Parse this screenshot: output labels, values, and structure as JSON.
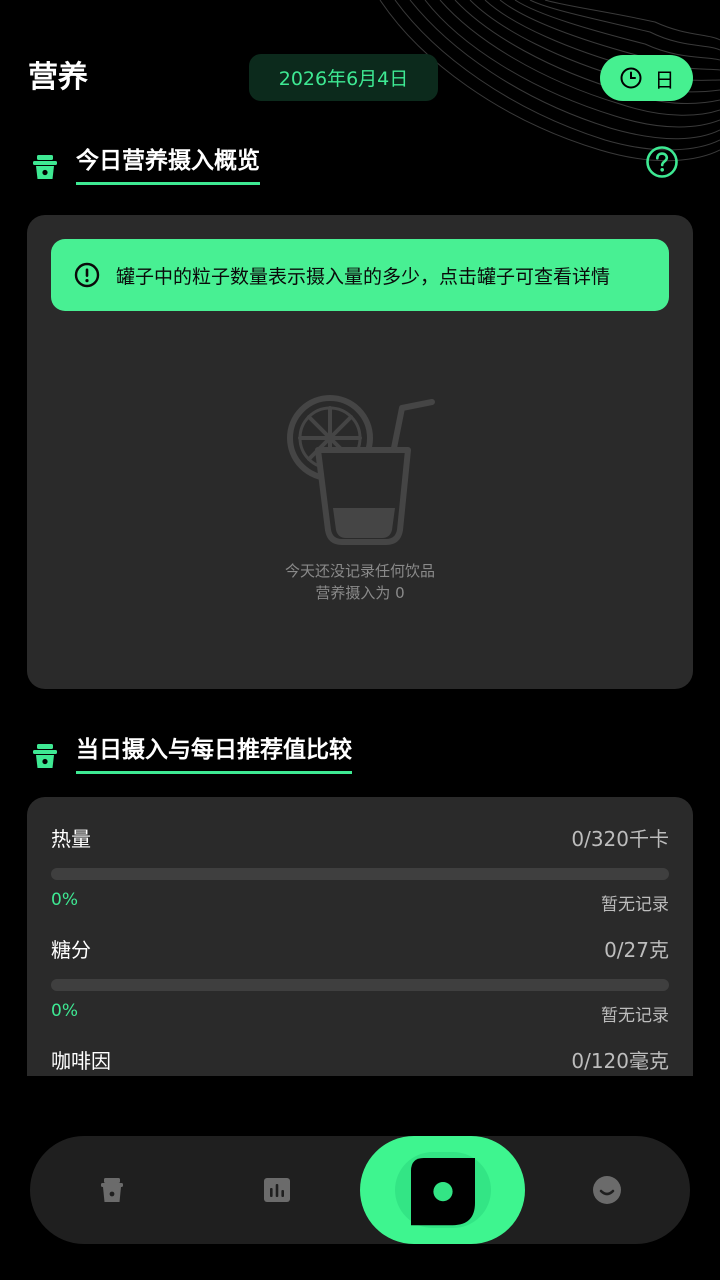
{
  "header": {
    "title": "营养",
    "date": "2026年6月4日",
    "mode_label": "日"
  },
  "overview": {
    "section_title": "今日营养摄入概览",
    "tip": "罐子中的粒子数量表示摄入量的多少，点击罐子可查看详情",
    "empty_line1": "今天还没记录任何饮品",
    "empty_line2": "营养摄入为 0"
  },
  "compare": {
    "section_title": "当日摄入与每日推荐值比较",
    "metrics": [
      {
        "name": "热量",
        "value": "0/320千卡",
        "percent": "0%",
        "progress": 0,
        "note": "暂无记录"
      },
      {
        "name": "糖分",
        "value": "0/27克",
        "percent": "0%",
        "progress": 0,
        "note": "暂无记录"
      },
      {
        "name": "咖啡因",
        "value": "0/120毫克"
      }
    ]
  },
  "nav": {
    "items": [
      "cup-icon",
      "chart-icon",
      "nutrition-icon",
      "face-icon"
    ],
    "active": "nutrition-icon"
  },
  "colors": {
    "accent": "#3ee993",
    "background": "#000000",
    "card": "#2a2a2a",
    "tip_bg": "#48f093"
  }
}
